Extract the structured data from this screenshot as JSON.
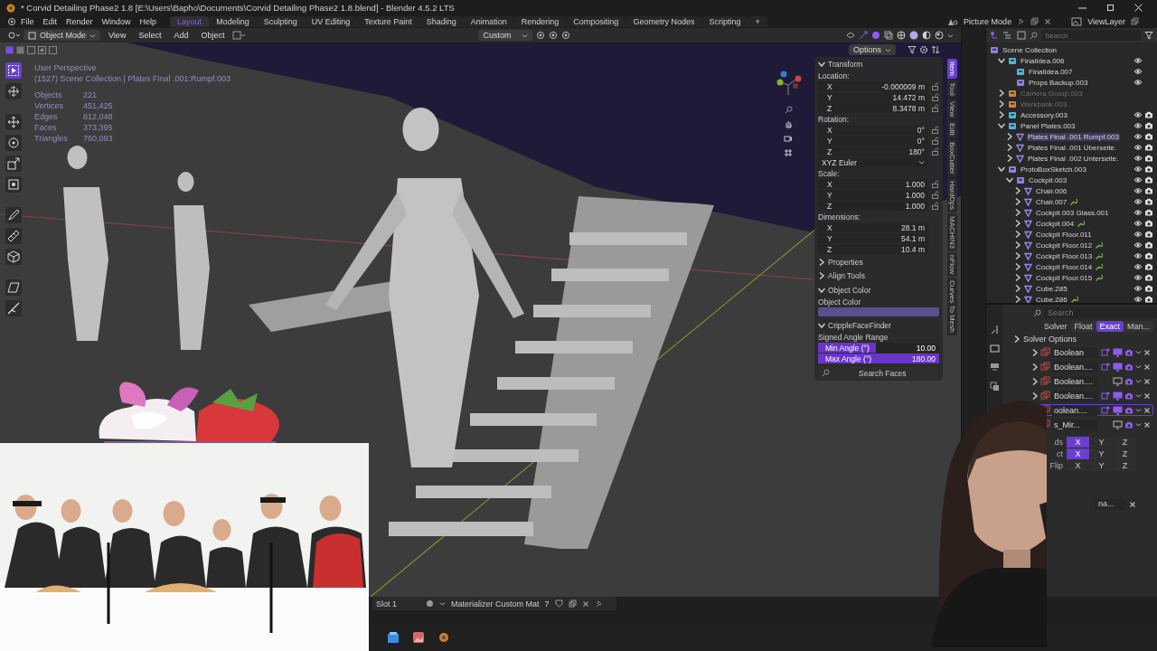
{
  "window": {
    "title": "* Corvid Detailing Phase2 1.8 [E:\\Users\\Bapho\\Documents\\Corvid Detailing Phase2 1.8.blend] - Blender 4.5.2 LTS"
  },
  "menu": [
    "File",
    "Edit",
    "Render",
    "Window",
    "Help"
  ],
  "workspaces": [
    {
      "label": "Layout",
      "selected": true
    },
    {
      "label": "Modeling",
      "selected": false
    },
    {
      "label": "Sculpting",
      "selected": false
    },
    {
      "label": "UV Editing",
      "selected": false
    },
    {
      "label": "Texture Paint",
      "selected": false
    },
    {
      "label": "Shading",
      "selected": false
    },
    {
      "label": "Animation",
      "selected": false
    },
    {
      "label": "Rendering",
      "selected": false
    },
    {
      "label": "Compositing",
      "selected": false
    },
    {
      "label": "Geometry Nodes",
      "selected": false
    },
    {
      "label": "Scripting",
      "selected": false
    }
  ],
  "add_workspace": "+",
  "scene": "Picture Mode",
  "view_layer": "ViewLayer",
  "viewport_header": {
    "mode": "Object Mode",
    "menus": [
      "View",
      "Select",
      "Add",
      "Object"
    ],
    "orientation": "Custom",
    "options": "Options"
  },
  "tools": [
    {
      "kind": "select",
      "selected": true
    },
    {
      "kind": "cursor",
      "selected": false
    },
    {
      "kind": "move",
      "selected": false
    },
    {
      "kind": "rotate",
      "selected": false
    },
    {
      "kind": "scale",
      "selected": false
    },
    {
      "kind": "transform",
      "selected": false
    },
    {
      "kind": "annotate",
      "selected": false
    },
    {
      "kind": "measure",
      "selected": false
    },
    {
      "kind": "add-cube",
      "selected": false
    },
    {
      "kind": "shear",
      "selected": false
    },
    {
      "kind": "knife",
      "selected": false
    }
  ],
  "viewport": {
    "perspective": "User Perspective",
    "context": "(1527) Scene Collection | Plates Final .001:Rumpf.003",
    "stats": [
      {
        "label": "Objects",
        "value": "221"
      },
      {
        "label": "Vertices",
        "value": "451,425"
      },
      {
        "label": "Edges",
        "value": "812,048"
      },
      {
        "label": "Faces",
        "value": "373,395"
      },
      {
        "label": "Triangles",
        "value": "760,093"
      }
    ]
  },
  "sidebar": {
    "tabs": [
      {
        "label": "Item",
        "selected": true
      },
      {
        "label": "Tool",
        "selected": false
      },
      {
        "label": "View",
        "selected": false
      },
      {
        "label": "Edit",
        "selected": false
      },
      {
        "label": "BoxCutter",
        "selected": false
      },
      {
        "label": "HardOps",
        "selected": false
      },
      {
        "label": "MACHIN3",
        "selected": false
      },
      {
        "label": "nFlow",
        "selected": false
      },
      {
        "label": "Curves To Mesh",
        "selected": false
      }
    ],
    "transform": {
      "title": "Transform",
      "expanded": true,
      "groups": [
        {
          "label": "Location:",
          "kind": "lockable",
          "rows": [
            {
              "axis": "X",
              "value": "-0.000009 m",
              "locked": false
            },
            {
              "axis": "Y",
              "value": "14.472 m",
              "locked": false
            },
            {
              "axis": "Z",
              "value": "8.3478 m",
              "locked": false
            }
          ]
        },
        {
          "label": "Rotation:",
          "kind": "lockable",
          "mode": "XYZ Euler",
          "rows": [
            {
              "axis": "X",
              "value": "0°",
              "locked": false
            },
            {
              "axis": "Y",
              "value": "0°",
              "locked": false
            },
            {
              "axis": "Z",
              "value": "180°",
              "locked": false
            }
          ]
        },
        {
          "label": "Scale:",
          "kind": "lockable",
          "rows": [
            {
              "axis": "X",
              "value": "1.000",
              "locked": false
            },
            {
              "axis": "Y",
              "value": "1.000",
              "locked": false
            },
            {
              "axis": "Z",
              "value": "1.000",
              "locked": false
            }
          ]
        },
        {
          "label": "Dimensions:",
          "kind": "plain",
          "rows": [
            {
              "axis": "X",
              "value": "28.1 m"
            },
            {
              "axis": "Y",
              "value": "54.1 m"
            },
            {
              "axis": "Z",
              "value": "10.4 m"
            }
          ]
        }
      ]
    },
    "panels": [
      {
        "label": "Properties",
        "kind": "closed",
        "expanded": false
      },
      {
        "label": "Align Tools",
        "kind": "closed",
        "expanded": false
      },
      {
        "label": "Object Color",
        "kind": "color",
        "expanded": true,
        "field_label": "Object Color"
      },
      {
        "label": "CrippleFaceFinder",
        "kind": "finder",
        "expanded": true,
        "range_label": "Signed Angle Range",
        "sliders": [
          {
            "label": "Min Angle (°)",
            "value": "10.00",
            "level": 0.48
          },
          {
            "label": "Max Angle (°)",
            "value": "180.00",
            "level": 1
          }
        ],
        "button": "Search Faces"
      }
    ]
  },
  "outliner": {
    "search": {
      "placeholder": "Search"
    },
    "root": "Scene Collection",
    "items": [
      {
        "label": "FinalIdea.006",
        "kind": "collection",
        "color": "#4fb6d8",
        "expandable": true,
        "expanded": true,
        "dimmed": false,
        "render": false,
        "modifier": false,
        "selected": false,
        "children": [
          {
            "label": "FinalIdea.007",
            "kind": "collection",
            "color": "#4fb6d8",
            "dimmed": false,
            "render": false,
            "modifier": false,
            "selected": false
          },
          {
            "label": "Props Backup.003",
            "kind": "collection",
            "color": "#8f7fe0",
            "dimmed": false,
            "render": false,
            "modifier": false,
            "selected": false
          }
        ]
      },
      {
        "label": "Camera Group.003",
        "kind": "collection",
        "color": "#c9843a",
        "expandable": true,
        "expanded": false,
        "dimmed": true,
        "render": false,
        "modifier": false,
        "selected": false
      },
      {
        "label": "Werkbank.003",
        "kind": "collection",
        "color": "#c9843a",
        "expandable": true,
        "expanded": false,
        "dimmed": true,
        "render": false,
        "modifier": false,
        "selected": false
      },
      {
        "label": "Accessory.003",
        "kind": "collection",
        "color": "#4fb6d8",
        "expandable": true,
        "expanded": false,
        "dimmed": false,
        "render": true,
        "modifier": false,
        "selected": false
      },
      {
        "label": "Panel Plates.003",
        "kind": "collection",
        "color": "#4fb6d8",
        "expandable": true,
        "expanded": true,
        "dimmed": false,
        "render": true,
        "modifier": false,
        "selected": false,
        "children": [
          {
            "label": "Plates Final .001 Rumpf.003",
            "kind": "mesh",
            "expandable": true,
            "expanded": false,
            "dimmed": false,
            "render": true,
            "modifier": false,
            "selected": true
          },
          {
            "label": "Plates Final .001 Überseite.",
            "kind": "mesh",
            "expandable": true,
            "expanded": false,
            "dimmed": false,
            "render": true,
            "modifier": false,
            "selected": false
          },
          {
            "label": "Plates Final .002 Unterseite.",
            "kind": "mesh",
            "expandable": true,
            "expanded": false,
            "dimmed": false,
            "render": true,
            "modifier": false,
            "selected": false
          }
        ]
      },
      {
        "label": "ProtoBoxSketch.003",
        "kind": "collection",
        "color": "#8f7fe0",
        "expandable": true,
        "expanded": true,
        "dimmed": false,
        "render": true,
        "modifier": false,
        "selected": false,
        "children": [
          {
            "label": "Cockpit.003",
            "kind": "collection",
            "color": "#8f7fe0",
            "expandable": true,
            "expanded": true,
            "dimmed": false,
            "render": true,
            "modifier": false,
            "selected": false,
            "children": [
              {
                "label": "Chair.006",
                "kind": "mesh",
                "expandable": true,
                "expanded": false,
                "dimmed": false,
                "render": true,
                "modifier": false,
                "selected": false
              },
              {
                "label": "Chair.007",
                "kind": "mesh",
                "expandable": true,
                "expanded": false,
                "dimmed": false,
                "render": true,
                "modifier": true,
                "selected": false
              },
              {
                "label": "Cockpit.003 Glass.001",
                "kind": "mesh",
                "expandable": true,
                "expanded": false,
                "dimmed": false,
                "render": true,
                "modifier": false,
                "selected": false
              },
              {
                "label": "Cockpit.004",
                "kind": "mesh",
                "expandable": true,
                "expanded": false,
                "dimmed": false,
                "render": true,
                "modifier": true,
                "selected": false
              },
              {
                "label": "Cockpit Floor.011",
                "kind": "mesh",
                "expandable": true,
                "expanded": false,
                "dimmed": false,
                "render": true,
                "modifier": false,
                "selected": false
              },
              {
                "label": "Cockpit Floor.012",
                "kind": "mesh",
                "expandable": true,
                "expanded": false,
                "dimmed": false,
                "render": true,
                "modifier": true,
                "selected": false
              },
              {
                "label": "Cockpit Floor.013",
                "kind": "mesh",
                "expandable": true,
                "expanded": false,
                "dimmed": false,
                "render": true,
                "modifier": true,
                "selected": false
              },
              {
                "label": "Cockpit Floor.014",
                "kind": "mesh",
                "expandable": true,
                "expanded": false,
                "dimmed": false,
                "render": true,
                "modifier": true,
                "selected": false
              },
              {
                "label": "Cockpit Floor.015",
                "kind": "mesh",
                "expandable": true,
                "expanded": false,
                "dimmed": false,
                "render": true,
                "modifier": true,
                "selected": false
              },
              {
                "label": "Cube.285",
                "kind": "mesh",
                "expandable": true,
                "expanded": false,
                "dimmed": false,
                "render": true,
                "modifier": false,
                "selected": false
              },
              {
                "label": "Cube.286",
                "kind": "mesh",
                "expandable": true,
                "expanded": false,
                "dimmed": false,
                "render": true,
                "modifier": true,
                "selected": false
              }
            ]
          }
        ]
      }
    ]
  },
  "properties": {
    "search": {
      "placeholder": "Search"
    },
    "solver_label": "Solver",
    "solver": [
      {
        "label": "Float",
        "selected": false
      },
      {
        "label": "Exact",
        "selected": true
      },
      {
        "label": "Man...",
        "selected": false
      }
    ],
    "solver_options": {
      "label": "Solver Options",
      "expanded": false
    },
    "modifiers": [
      {
        "name": "Boolean",
        "expanded": false,
        "editmode": true,
        "viewport": true,
        "active": false
      },
      {
        "name": "Boolean....",
        "expanded": false,
        "editmode": true,
        "viewport": true,
        "active": false
      },
      {
        "name": "Boolean....",
        "expanded": false,
        "editmode": false,
        "viewport": false,
        "active": false
      },
      {
        "name": "Boolean....",
        "expanded": false,
        "editmode": true,
        "viewport": true,
        "active": false
      },
      {
        "name": "oolean....",
        "editmode": true,
        "viewport": true,
        "active": true
      },
      {
        "name": "s_Mir...",
        "editmode": false,
        "viewport": false,
        "active": false
      }
    ],
    "axis_rows": [
      {
        "label": "ds",
        "buttons": [
          {
            "label": "X",
            "selected": true
          },
          {
            "label": "Y",
            "selected": false
          },
          {
            "label": "Z",
            "selected": false
          }
        ]
      },
      {
        "label": "ct",
        "buttons": [
          {
            "label": "X",
            "selected": true
          },
          {
            "label": "Y",
            "selected": false
          },
          {
            "label": "Z",
            "selected": false
          }
        ]
      },
      {
        "label": "Flip",
        "buttons": [
          {
            "label": "X",
            "selected": false
          },
          {
            "label": "Y",
            "selected": false
          },
          {
            "label": "Z",
            "selected": false
          }
        ]
      }
    ],
    "object_field": "na..."
  },
  "bottom": {
    "slot": "Slot 1",
    "material": "Materializer Custom Mat",
    "users": "7"
  }
}
